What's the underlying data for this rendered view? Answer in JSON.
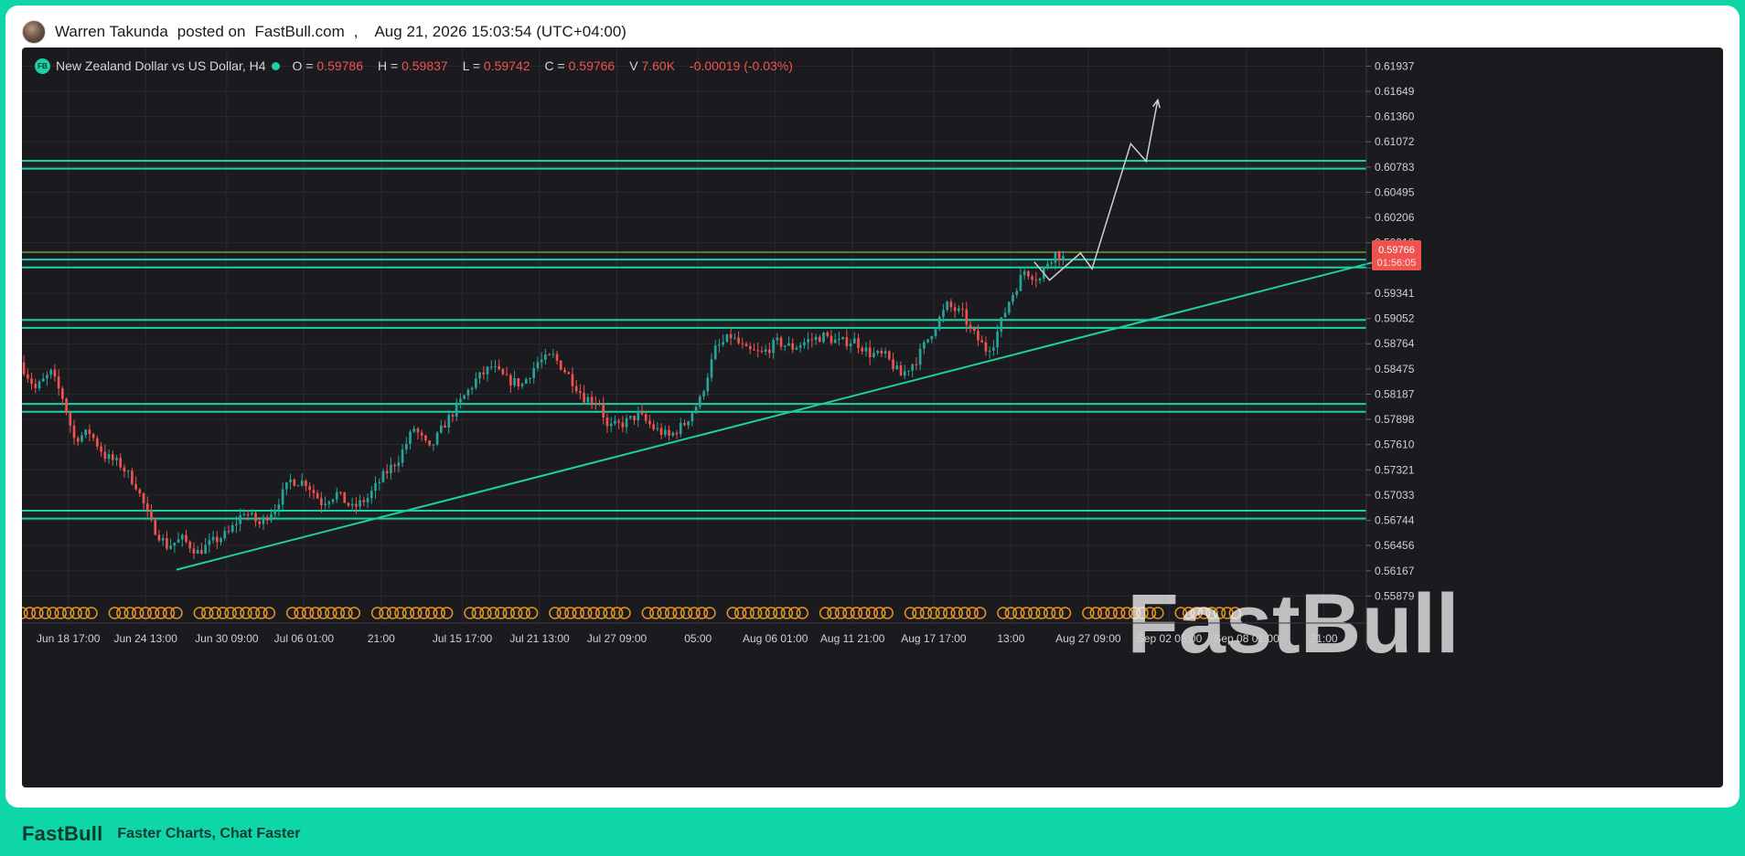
{
  "post": {
    "author": "Warren Takunda",
    "verb": "posted on",
    "site": "FastBull.com",
    "separator": ",",
    "date": "Aug 21, 2026 15:03:54 (UTC+04:00)"
  },
  "legend": {
    "badge": "FB",
    "symbol": "New Zealand Dollar vs US Dollar, H4",
    "open_label": "O = ",
    "open": "0.59786",
    "high_label": "H = ",
    "high": "0.59837",
    "low_label": "L = ",
    "low": "0.59742",
    "close_label": "C = ",
    "close": "0.59766",
    "volume_label": "V",
    "volume": "7.60K",
    "change": "-0.00019 (-0.03%)"
  },
  "price_tag": {
    "price": "0.59766",
    "countdown": "01:56:05"
  },
  "watermark": "FastBull",
  "footer": {
    "logo": "FastBull",
    "tagline": "Faster Charts, Chat Faster"
  },
  "colors": {
    "up": "#26a69a",
    "down": "#ef5350",
    "zone": "#1ecfa3",
    "background": "#1b1b1f",
    "grid": "#2a2a2f",
    "projection": "#d0d0d0",
    "event": "#e6951e"
  },
  "chart_data": {
    "type": "candlestick",
    "title": "New Zealand Dollar vs US Dollar, H4",
    "y_ticks": [
      0.61937,
      0.61649,
      0.6136,
      0.61072,
      0.60783,
      0.60495,
      0.60206,
      0.59918,
      0.5963,
      0.59341,
      0.59052,
      0.58764,
      0.58475,
      0.58187,
      0.57898,
      0.5761,
      0.57321,
      0.57033,
      0.56744,
      0.56456,
      0.56167,
      0.55879
    ],
    "y_tick_labels": [
      "0.61937",
      "0.61649",
      "0.61360",
      "0.61072",
      "0.60783",
      "0.60495",
      "0.60206",
      "0.59918",
      "",
      "0.59341",
      "0.59052",
      "0.58764",
      "0.58475",
      "0.58187",
      "0.57898",
      "0.57610",
      "0.57321",
      "0.57033",
      "0.56744",
      "0.56456",
      "0.56167",
      "0.55879"
    ],
    "ylim": [
      0.5557,
      0.6215
    ],
    "x_ticks": [
      {
        "label": "Jun 18 17:00",
        "bar": 12
      },
      {
        "label": "Jun 24 13:00",
        "bar": 32
      },
      {
        "label": "Jun 30 09:00",
        "bar": 53
      },
      {
        "label": "Jul 06 01:00",
        "bar": 73
      },
      {
        "label": "21:00",
        "bar": 93
      },
      {
        "label": "Jul 15 17:00",
        "bar": 114
      },
      {
        "label": "Jul 21 13:00",
        "bar": 134
      },
      {
        "label": "Jul 27 09:00",
        "bar": 154
      },
      {
        "label": "05:00",
        "bar": 175
      },
      {
        "label": "Aug 06 01:00",
        "bar": 195
      },
      {
        "label": "Aug 11 21:00",
        "bar": 215
      },
      {
        "label": "Aug 17 17:00",
        "bar": 236
      },
      {
        "label": "13:00",
        "bar": 256
      },
      {
        "label": "Aug 27 09:00",
        "bar": 276
      },
      {
        "label": "Sep 02 05:00",
        "bar": 297
      },
      {
        "label": "Sep 08 01:00",
        "bar": 317
      },
      {
        "label": "21:00",
        "bar": 337
      }
    ],
    "x_range": [
      0,
      348
    ],
    "anchors": [
      [
        0,
        0.5855
      ],
      [
        4,
        0.5825
      ],
      [
        8,
        0.5843
      ],
      [
        11,
        0.5815
      ],
      [
        14,
        0.5768
      ],
      [
        18,
        0.5775
      ],
      [
        22,
        0.5748
      ],
      [
        26,
        0.5738
      ],
      [
        30,
        0.5715
      ],
      [
        34,
        0.567
      ],
      [
        38,
        0.5645
      ],
      [
        42,
        0.5653
      ],
      [
        46,
        0.5638
      ],
      [
        50,
        0.565
      ],
      [
        54,
        0.566
      ],
      [
        58,
        0.5685
      ],
      [
        62,
        0.567
      ],
      [
        66,
        0.569
      ],
      [
        70,
        0.572
      ],
      [
        74,
        0.5718
      ],
      [
        78,
        0.5695
      ],
      [
        82,
        0.5705
      ],
      [
        86,
        0.5688
      ],
      [
        90,
        0.57
      ],
      [
        94,
        0.5725
      ],
      [
        98,
        0.5745
      ],
      [
        102,
        0.578
      ],
      [
        106,
        0.5755
      ],
      [
        110,
        0.5785
      ],
      [
        114,
        0.581
      ],
      [
        118,
        0.5835
      ],
      [
        122,
        0.585
      ],
      [
        126,
        0.5835
      ],
      [
        130,
        0.583
      ],
      [
        134,
        0.5855
      ],
      [
        138,
        0.5862
      ],
      [
        142,
        0.584
      ],
      [
        146,
        0.5815
      ],
      [
        150,
        0.581
      ],
      [
        152,
        0.578
      ],
      [
        156,
        0.5785
      ],
      [
        160,
        0.5795
      ],
      [
        164,
        0.578
      ],
      [
        168,
        0.577
      ],
      [
        172,
        0.5785
      ],
      [
        176,
        0.5812
      ],
      [
        180,
        0.587
      ],
      [
        184,
        0.5885
      ],
      [
        188,
        0.5868
      ],
      [
        192,
        0.5865
      ],
      [
        196,
        0.5878
      ],
      [
        200,
        0.5872
      ],
      [
        204,
        0.588
      ],
      [
        208,
        0.5885
      ],
      [
        212,
        0.5878
      ],
      [
        216,
        0.588
      ],
      [
        220,
        0.5865
      ],
      [
        224,
        0.5862
      ],
      [
        228,
        0.584
      ],
      [
        232,
        0.5858
      ],
      [
        236,
        0.589
      ],
      [
        240,
        0.592
      ],
      [
        244,
        0.591
      ],
      [
        246,
        0.5892
      ],
      [
        250,
        0.587
      ],
      [
        252,
        0.5878
      ],
      [
        256,
        0.5925
      ],
      [
        260,
        0.596
      ],
      [
        262,
        0.5955
      ],
      [
        264,
        0.595
      ],
      [
        266,
        0.597
      ],
      [
        268,
        0.598
      ],
      [
        269,
        0.59766
      ]
    ],
    "zones": [
      {
        "from": 0.60765,
        "to": 0.60855
      },
      {
        "from": 0.59635,
        "to": 0.59725
      },
      {
        "from": 0.58945,
        "to": 0.59035
      },
      {
        "from": 0.57985,
        "to": 0.58075
      },
      {
        "from": 0.56765,
        "to": 0.56855
      }
    ],
    "resistance_line": 0.5981,
    "trendline": [
      [
        40,
        0.5618
      ],
      [
        360,
        0.5981
      ]
    ],
    "projection": [
      [
        262,
        0.597
      ],
      [
        266,
        0.5949
      ],
      [
        274,
        0.598
      ],
      [
        277,
        0.5962
      ],
      [
        287,
        0.6105
      ],
      [
        291,
        0.6085
      ],
      [
        294,
        0.6155
      ]
    ],
    "event_markers_until_bar": 315
  }
}
